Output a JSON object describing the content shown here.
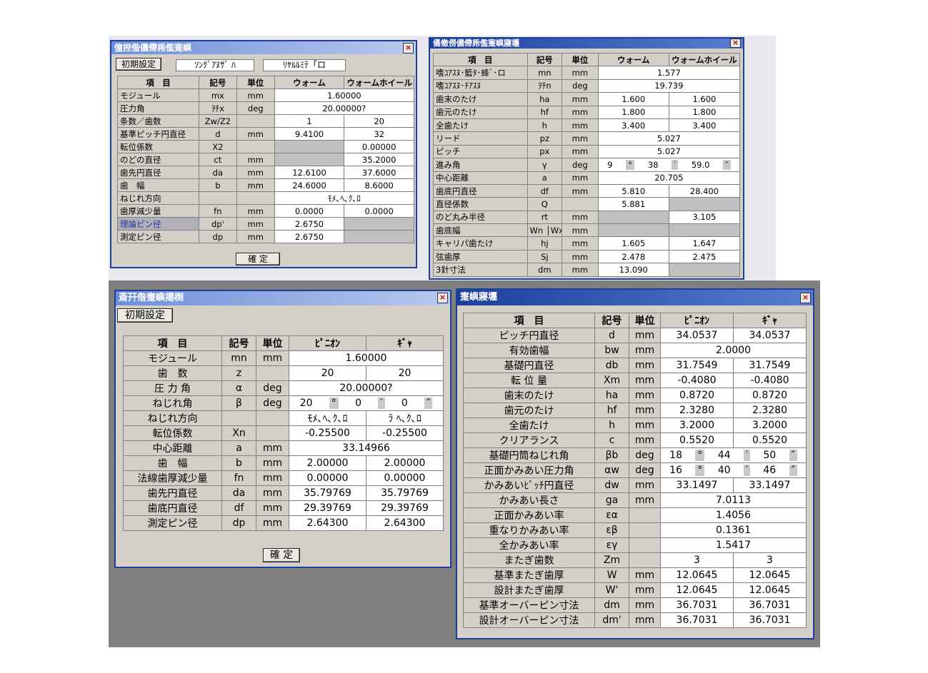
{
  "windows": {
    "a": {
      "title": "僮揑偺儂僀乕儖寁嶼",
      "btn_init": "初期設定",
      "field1": "ｿﾝｸﾞｱﾇｻﾞ ﾊ",
      "field2": "ﾘﾔﾙﾙﾐﾃ「ロ",
      "confirm": "確 定",
      "headers": [
        "項　目",
        "記号",
        "単位",
        "ウォーム",
        "ウォームホイール"
      ],
      "rows": [
        {
          "item": "モジュール",
          "sym": "mx",
          "unit": "mm",
          "span": "1.60000"
        },
        {
          "item": "圧力角",
          "sym": "ｦﾁx",
          "unit": "deg",
          "span": "20.00000?"
        },
        {
          "item": "条数／歯数",
          "sym": "Zw/Z2",
          "unit": "",
          "v1": "1",
          "v2": "20"
        },
        {
          "item": "基準ピッチ円直径",
          "sym": "d",
          "unit": "mm",
          "v1": "9.4100",
          "v2": "32"
        },
        {
          "item": "転位係数",
          "sym": "X2",
          "unit": "",
          "v1": "",
          "v2": "0.00000"
        },
        {
          "item": "のどの直径",
          "sym": "ct",
          "unit": "mm",
          "v1": "",
          "v2": "35.2000"
        },
        {
          "item": "歯先円直径",
          "sym": "da",
          "unit": "mm",
          "v1": "12.6100",
          "v2": "37.6000"
        },
        {
          "item": "歯　幅",
          "sym": "b",
          "unit": "mm",
          "v1": "24.6000",
          "v2": "8.6000"
        },
        {
          "item": "ねじれ方向",
          "sym": "",
          "unit": "",
          "span": "ﾓﾒ､ﾍ､ｸ､ﾛ"
        },
        {
          "item": "歯厚減少量",
          "sym": "fn",
          "unit": "mm",
          "v1": "0.0000",
          "v2": "0.0000"
        },
        {
          "item": "理論ピン径",
          "sym": "dp'",
          "unit": "mm",
          "v1": "2.6750",
          "v2": ""
        },
        {
          "item": "測定ピン径",
          "sym": "dp",
          "unit": "mm",
          "v1": "2.6750",
          "v2": ""
        }
      ]
    },
    "b": {
      "title": "僪僌僗儂僀乕儖寁嶼寢壥",
      "headers": [
        "項　目",
        "記号",
        "単位",
        "ウォーム",
        "ウォームホイール"
      ],
      "rows": [
        {
          "item": "嗜ｺｱｽﾇ･籃ﾀ･蜂ﾞ･ロ",
          "sym": "mn",
          "unit": "mm",
          "span": "1.577"
        },
        {
          "item": "嗜ｺｱｽﾇ･ﾁｱｽﾇ",
          "sym": "ｦﾁn",
          "unit": "deg",
          "span": "19.739"
        },
        {
          "item": "歯末のたけ",
          "sym": "ha",
          "unit": "mm",
          "v1": "1.600",
          "v2": "1.600"
        },
        {
          "item": "歯元のたけ",
          "sym": "hf",
          "unit": "mm",
          "v1": "1.800",
          "v2": "1.800"
        },
        {
          "item": "全歯たけ",
          "sym": "h",
          "unit": "mm",
          "v1": "3.400",
          "v2": "3.400"
        },
        {
          "item": "リード",
          "sym": "pz",
          "unit": "mm",
          "span": "5.027"
        },
        {
          "item": "ピッチ",
          "sym": "px",
          "unit": "mm",
          "span": "5.027"
        },
        {
          "item": "進み角",
          "sym": "γ",
          "unit": "deg",
          "angle": [
            "9",
            "38",
            "59.0"
          ]
        },
        {
          "item": "中心距離",
          "sym": "a",
          "unit": "mm",
          "span": "20.705"
        },
        {
          "item": "歯底円直径",
          "sym": "df",
          "unit": "mm",
          "v1": "5.810",
          "v2": "28.400"
        },
        {
          "item": "直径係数",
          "sym": "Q",
          "unit": "",
          "v1": "5.881",
          "v2": ""
        },
        {
          "item": "のど丸み半径",
          "sym": "rt",
          "unit": "mm",
          "v1": "",
          "v2": "3.105"
        },
        {
          "item": "歯底幅",
          "sym": "Wn │Wx",
          "unit": "mm",
          "v1": "",
          "v2": ""
        },
        {
          "item": "キャリパ歯たけ",
          "sym": "hj",
          "unit": "mm",
          "v1": "1.605",
          "v2": "1.647"
        },
        {
          "item": "弦歯厚",
          "sym": "Sj",
          "unit": "mm",
          "v1": "2.478",
          "v2": "2.475"
        },
        {
          "item": "3針寸法",
          "sym": "dm",
          "unit": "mm",
          "v1": "13.090",
          "v2": ""
        }
      ]
    },
    "c": {
      "title": "斎幵偺寁嶼擖椡",
      "btn_init": "初期設定",
      "confirm": "確 定",
      "headers": [
        "項　目",
        "記号",
        "単位",
        "ﾋﾟﾆｵﾝ",
        "ｷﾞｬ"
      ],
      "rows": [
        {
          "item": "モジュール",
          "sym": "mn",
          "unit": "mm",
          "span": "1.60000"
        },
        {
          "item": "歯　数",
          "sym": "z",
          "unit": "",
          "v1": "20",
          "v2": "20"
        },
        {
          "item": "圧 力 角",
          "sym": "α",
          "unit": "deg",
          "span": "20.00000?"
        },
        {
          "item": "ねじれ角",
          "sym": "β",
          "unit": "deg",
          "angle": [
            "20",
            "0",
            "0"
          ]
        },
        {
          "item": "ねじれ方向",
          "sym": "",
          "unit": "",
          "v1": "ﾓﾒ､ﾍ､ｸ､ﾛ",
          "v2": "ﾗ ﾍ､ｸ､ﾛ"
        },
        {
          "item": "転位係数",
          "sym": "Xn",
          "unit": "",
          "v1": "-0.25500",
          "v2": "-0.25500"
        },
        {
          "item": "中心距離",
          "sym": "a",
          "unit": "mm",
          "span": "33.14966"
        },
        {
          "item": "歯　幅",
          "sym": "b",
          "unit": "mm",
          "v1": "2.00000",
          "v2": "2.00000"
        },
        {
          "item": "法線歯厚減少量",
          "sym": "fn",
          "unit": "mm",
          "v1": "0.00000",
          "v2": "0.00000"
        },
        {
          "item": "歯先円直径",
          "sym": "da",
          "unit": "mm",
          "v1": "35.79769",
          "v2": "35.79769"
        },
        {
          "item": "歯底円直径",
          "sym": "df",
          "unit": "mm",
          "v1": "29.39769",
          "v2": "29.39769"
        },
        {
          "item": "測定ピン径",
          "sym": "dp",
          "unit": "mm",
          "v1": "2.64300",
          "v2": "2.64300"
        }
      ]
    },
    "d": {
      "title": "寁嶼寢壥",
      "headers": [
        "項　目",
        "記号",
        "単位",
        "ﾋﾟﾆｵﾝ",
        "ｷﾞｬ"
      ],
      "rows": [
        {
          "item": "ピッチ円直径",
          "sym": "d",
          "unit": "mm",
          "v1": "34.0537",
          "v2": "34.0537"
        },
        {
          "item": "有効歯幅",
          "sym": "bw",
          "unit": "mm",
          "span": "2.0000"
        },
        {
          "item": "基礎円直径",
          "sym": "db",
          "unit": "mm",
          "v1": "31.7549",
          "v2": "31.7549"
        },
        {
          "item": "転 位 量",
          "sym": "Xm",
          "unit": "mm",
          "v1": "-0.4080",
          "v2": "-0.4080"
        },
        {
          "item": "歯末のたけ",
          "sym": "ha",
          "unit": "mm",
          "v1": "0.8720",
          "v2": "0.8720"
        },
        {
          "item": "歯元のたけ",
          "sym": "hf",
          "unit": "mm",
          "v1": "2.3280",
          "v2": "2.3280"
        },
        {
          "item": "全歯たけ",
          "sym": "h",
          "unit": "mm",
          "v1": "3.2000",
          "v2": "3.2000"
        },
        {
          "item": "クリアランス",
          "sym": "c",
          "unit": "mm",
          "v1": "0.5520",
          "v2": "0.5520"
        },
        {
          "item": "基礎円筒ねじれ角",
          "sym": "βb",
          "unit": "deg",
          "angle": [
            "18",
            "44",
            "50"
          ]
        },
        {
          "item": "正面かみあい圧力角",
          "sym": "αw",
          "unit": "deg",
          "angle": [
            "16",
            "40",
            "46"
          ]
        },
        {
          "item": "かみあいﾋﾟｯﾁ円直径",
          "sym": "dw",
          "unit": "mm",
          "v1": "33.1497",
          "v2": "33.1497"
        },
        {
          "item": "かみあい長さ",
          "sym": "ga",
          "unit": "mm",
          "span": "7.0113"
        },
        {
          "item": "正面かみあい率",
          "sym": "εα",
          "unit": "",
          "span": "1.4056"
        },
        {
          "item": "重なりかみあい率",
          "sym": "εβ",
          "unit": "",
          "span": "0.1361"
        },
        {
          "item": "全かみあい率",
          "sym": "εγ",
          "unit": "",
          "span": "1.5417"
        },
        {
          "item": "またぎ歯数",
          "sym": "Zm",
          "unit": "",
          "v1": "3",
          "v2": "3"
        },
        {
          "item": "基準またぎ歯厚",
          "sym": "W",
          "unit": "mm",
          "v1": "12.0645",
          "v2": "12.0645"
        },
        {
          "item": "設計またぎ歯厚",
          "sym": "W'",
          "unit": "mm",
          "v1": "12.0645",
          "v2": "12.0645"
        },
        {
          "item": "基準オーバーピン寸法",
          "sym": "dm",
          "unit": "mm",
          "v1": "36.7031",
          "v2": "36.7031"
        },
        {
          "item": "設計オーバーピン寸法",
          "sym": "dm'",
          "unit": "mm",
          "v1": "36.7031",
          "v2": "36.7031"
        }
      ]
    }
  }
}
